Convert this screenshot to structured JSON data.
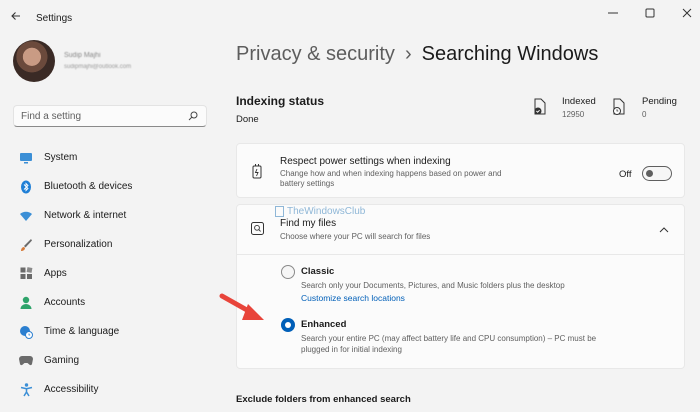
{
  "app": {
    "title": "Settings"
  },
  "profile": {
    "name": "Sudip Majhi",
    "email": "sudipmajhi@outlook.com"
  },
  "search": {
    "placeholder": "Find a setting"
  },
  "nav": [
    {
      "label": "System",
      "icon": "monitor-icon",
      "color": "#3b8fd6"
    },
    {
      "label": "Bluetooth & devices",
      "icon": "bluetooth-icon",
      "color": "#1f7fd6"
    },
    {
      "label": "Network & internet",
      "icon": "wifi-icon",
      "color": "#3b8fd6"
    },
    {
      "label": "Personalization",
      "icon": "brush-icon",
      "color": "#d67b3b"
    },
    {
      "label": "Apps",
      "icon": "apps-icon",
      "color": "#6b6b6b"
    },
    {
      "label": "Accounts",
      "icon": "person-icon",
      "color": "#2ea36a"
    },
    {
      "label": "Time & language",
      "icon": "globe-clock-icon",
      "color": "#2b7fd0"
    },
    {
      "label": "Gaming",
      "icon": "gamepad-icon",
      "color": "#6b6b6b"
    },
    {
      "label": "Accessibility",
      "icon": "accessibility-icon",
      "color": "#3b8fd6"
    }
  ],
  "header": {
    "parent": "Privacy & security",
    "separator": "›",
    "current": "Searching Windows"
  },
  "indexing": {
    "heading": "Indexing status",
    "status": "Done",
    "indexed_label": "Indexed",
    "indexed_value": "12950",
    "pending_label": "Pending",
    "pending_value": "0"
  },
  "power": {
    "title": "Respect power settings when indexing",
    "desc_line1": "Change how and when indexing happens based on power and",
    "desc_line2": "battery settings",
    "toggle_label": "Off",
    "toggle_on": false
  },
  "find_files": {
    "title": "Find my files",
    "desc": "Choose where your PC will search for files",
    "watermark": "TheWindowsClub",
    "classic": {
      "label": "Classic",
      "desc": "Search only your Documents, Pictures, and Music folders plus the desktop",
      "link": "Customize search locations",
      "selected": false
    },
    "enhanced": {
      "label": "Enhanced",
      "desc_line1": "Search your entire PC (may affect battery life and CPU consumption) – PC must be",
      "desc_line2": "plugged in for initial indexing",
      "selected": true
    }
  },
  "exclude": {
    "heading": "Exclude folders from enhanced search"
  },
  "colors": {
    "accent": "#005fb8",
    "arrow": "#e8443a"
  }
}
